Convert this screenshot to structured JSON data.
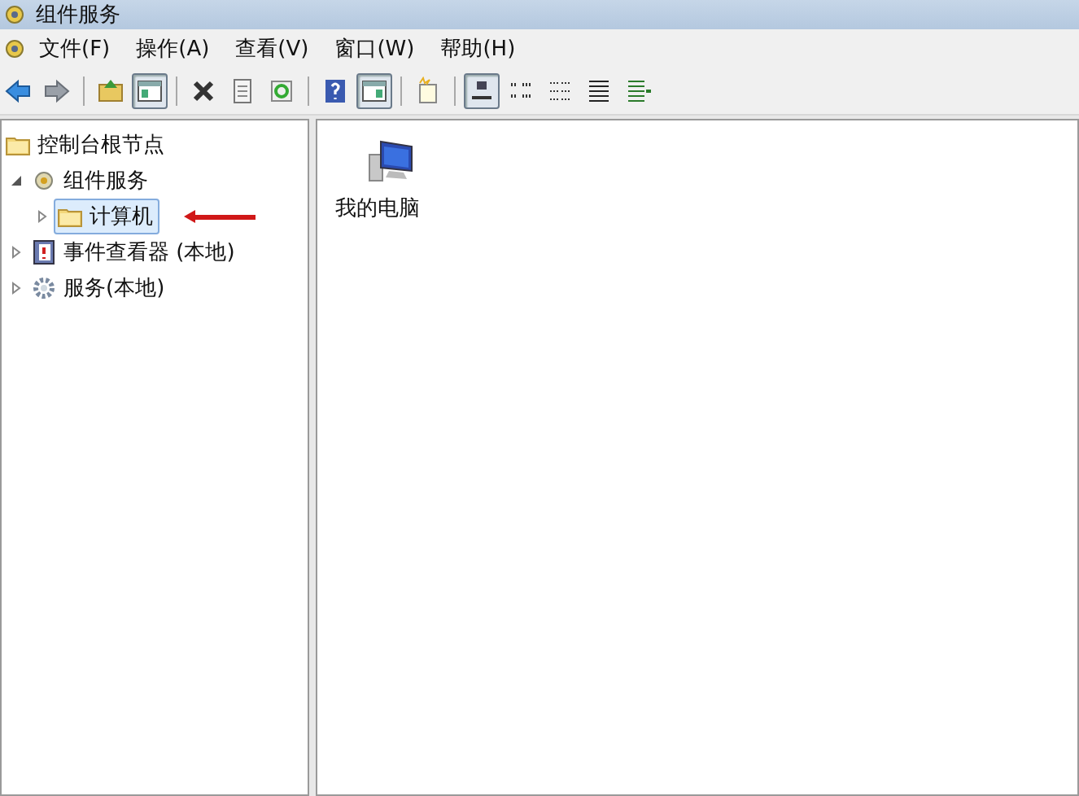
{
  "window": {
    "title": "组件服务"
  },
  "menu": [
    "文件(F)",
    "操作(A)",
    "查看(V)",
    "窗口(W)",
    "帮助(H)"
  ],
  "toolbar": [
    {
      "kind": "back",
      "pressed": false
    },
    {
      "kind": "forward",
      "pressed": false
    },
    {
      "kind": "separator"
    },
    {
      "kind": "up",
      "pressed": false
    },
    {
      "kind": "tree",
      "pressed": true
    },
    {
      "kind": "separator"
    },
    {
      "kind": "delete",
      "pressed": false
    },
    {
      "kind": "properties",
      "pressed": false
    },
    {
      "kind": "refresh",
      "pressed": false
    },
    {
      "kind": "separator"
    },
    {
      "kind": "help",
      "pressed": false
    },
    {
      "kind": "pane",
      "pressed": true
    },
    {
      "kind": "separator"
    },
    {
      "kind": "newwindow",
      "pressed": false
    },
    {
      "kind": "separator"
    },
    {
      "kind": "large",
      "pressed": true
    },
    {
      "kind": "small",
      "pressed": false
    },
    {
      "kind": "list",
      "pressed": false
    },
    {
      "kind": "details",
      "pressed": false
    },
    {
      "kind": "export",
      "pressed": false
    }
  ],
  "tree": [
    {
      "label": "控制台根节点",
      "kind": "folder",
      "selected": false,
      "children": [
        {
          "label": "组件服务",
          "kind": "component",
          "selected": false,
          "expanded": true,
          "children": [
            {
              "label": "计算机",
              "kind": "folder",
              "selected": true,
              "expanded": false
            }
          ]
        },
        {
          "label": "事件查看器 (本地)",
          "kind": "eventlog",
          "selected": false,
          "expanded": false
        },
        {
          "label": "服务(本地)",
          "kind": "gear",
          "selected": false,
          "expanded": false
        }
      ]
    }
  ],
  "items": [
    {
      "label": "我的电脑",
      "selected": false
    }
  ]
}
